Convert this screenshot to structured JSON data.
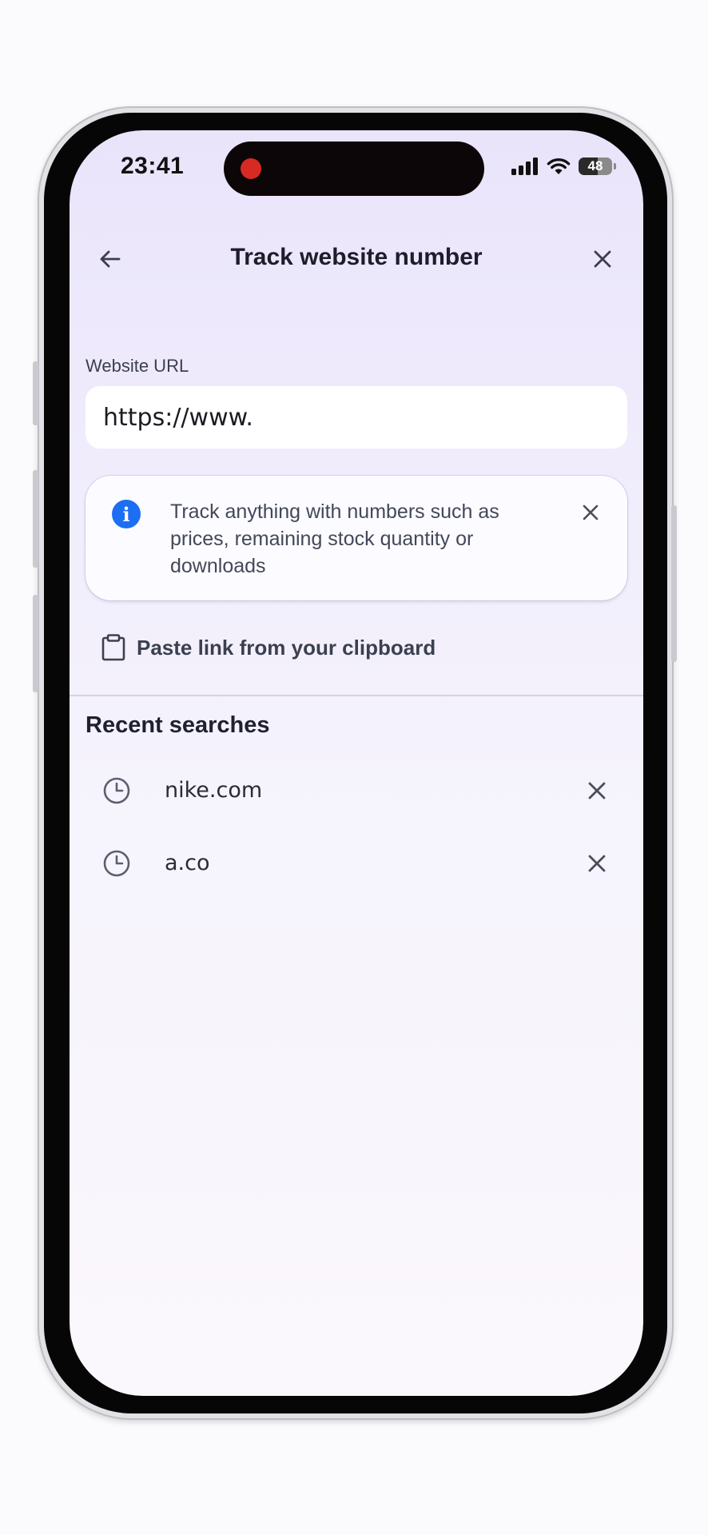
{
  "status_bar": {
    "time": "23:41",
    "battery": "48",
    "recording_color": "#d72a22"
  },
  "header": {
    "title": "Track website number",
    "back_icon": "arrow-left-icon",
    "close_icon": "close-icon"
  },
  "url_field": {
    "label": "Website URL",
    "value": "https://www."
  },
  "info_card": {
    "icon": "info-icon",
    "text": "Track anything with numbers such as prices, remaining stock quantity or downloads",
    "accent": "#1c6ef2"
  },
  "paste_action": {
    "icon": "clipboard-icon",
    "label": "Paste link from your clipboard"
  },
  "recent": {
    "title": "Recent searches",
    "items": [
      {
        "label": "nike.com",
        "icon": "clock-icon"
      },
      {
        "label": "a.co",
        "icon": "clock-icon"
      }
    ]
  }
}
